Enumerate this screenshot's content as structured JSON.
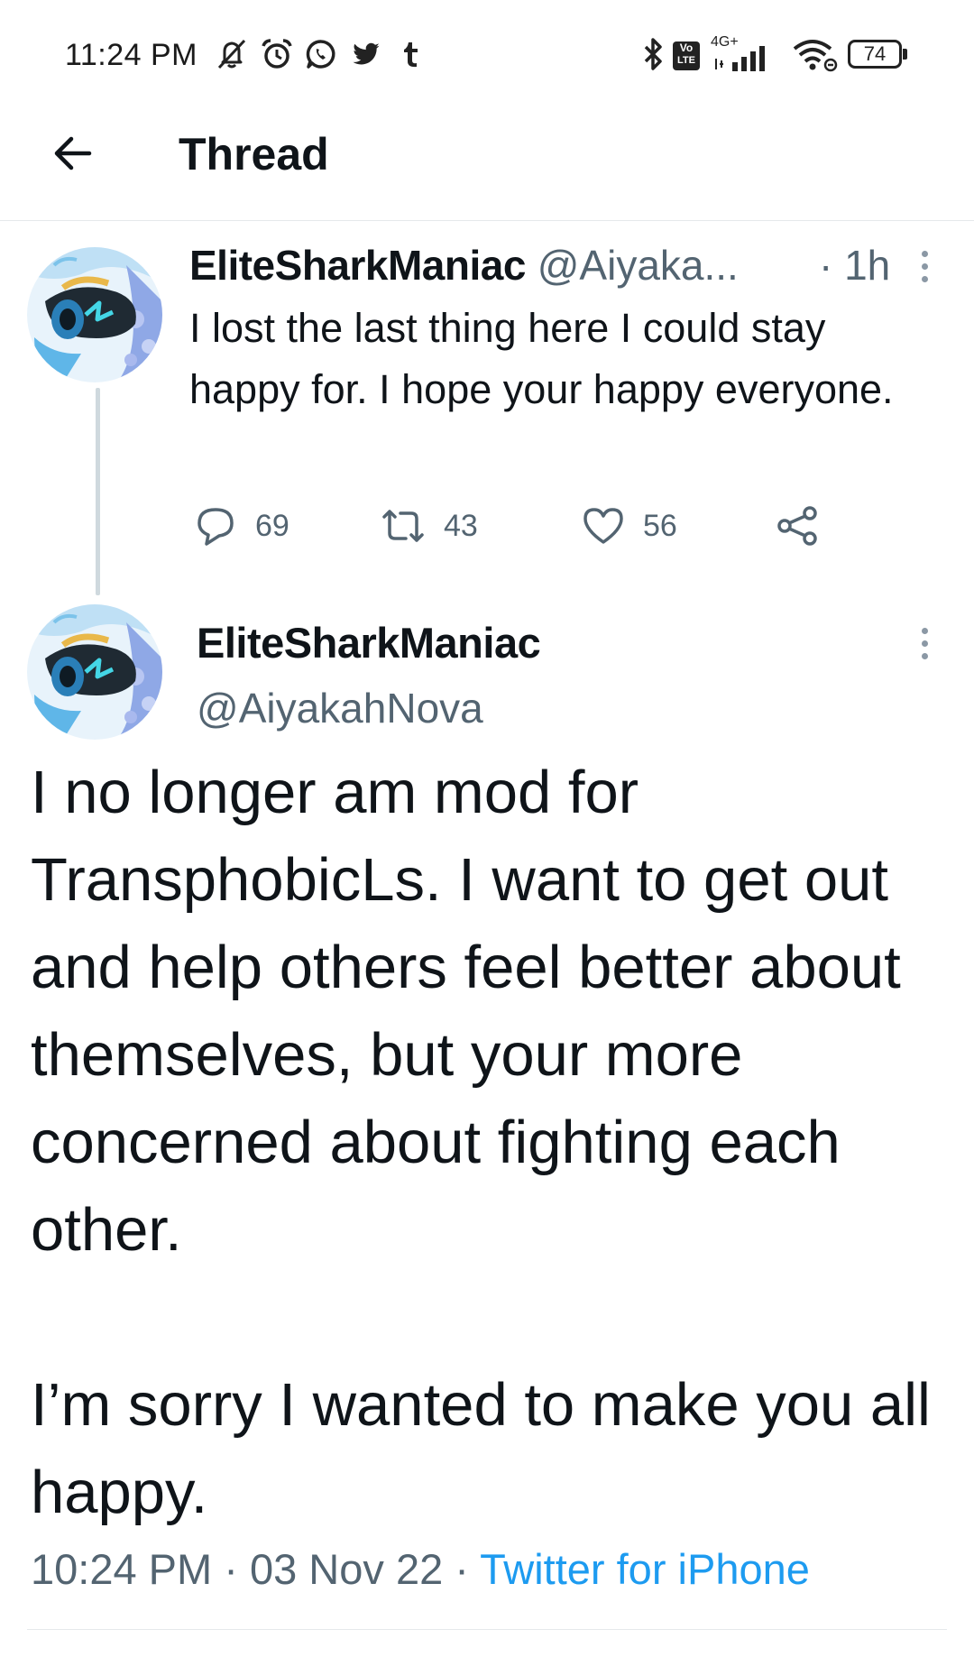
{
  "status_bar": {
    "time": "11:24 PM",
    "icons": [
      "muted-bell-icon",
      "alarm-icon",
      "whatsapp-icon",
      "twitter-bird-icon",
      "tumblr-icon"
    ],
    "network_label_top": "Vo",
    "network_label_bottom": "LTE",
    "signal_label": "4G+",
    "battery": "74"
  },
  "header": {
    "title": "Thread"
  },
  "tweet1": {
    "display_name": "EliteSharkManiac",
    "handle": "@Aiyaka...",
    "time": "· 1h",
    "text": "I lost the last thing here I could stay happy for. I hope your happy everyone.",
    "replies": "69",
    "retweets": "43",
    "likes": "56"
  },
  "main_tweet": {
    "display_name": "EliteSharkManiac",
    "handle": "@AiyakahNova",
    "text": "I no longer am mod for TransphobicLs. I want to get out and help others feel better about themselves, but your more concerned about fighting each other.\n\nI’m sorry I wanted to make you all happy.",
    "time": "10:24 PM",
    "separator": " · ",
    "date": "03 Nov 22",
    "source": "Twitter for iPhone"
  },
  "colors": {
    "accent": "#1d9bf0",
    "secondary_text": "#536471",
    "primary_text": "#0f1419",
    "thread_line": "#cfd9de"
  }
}
